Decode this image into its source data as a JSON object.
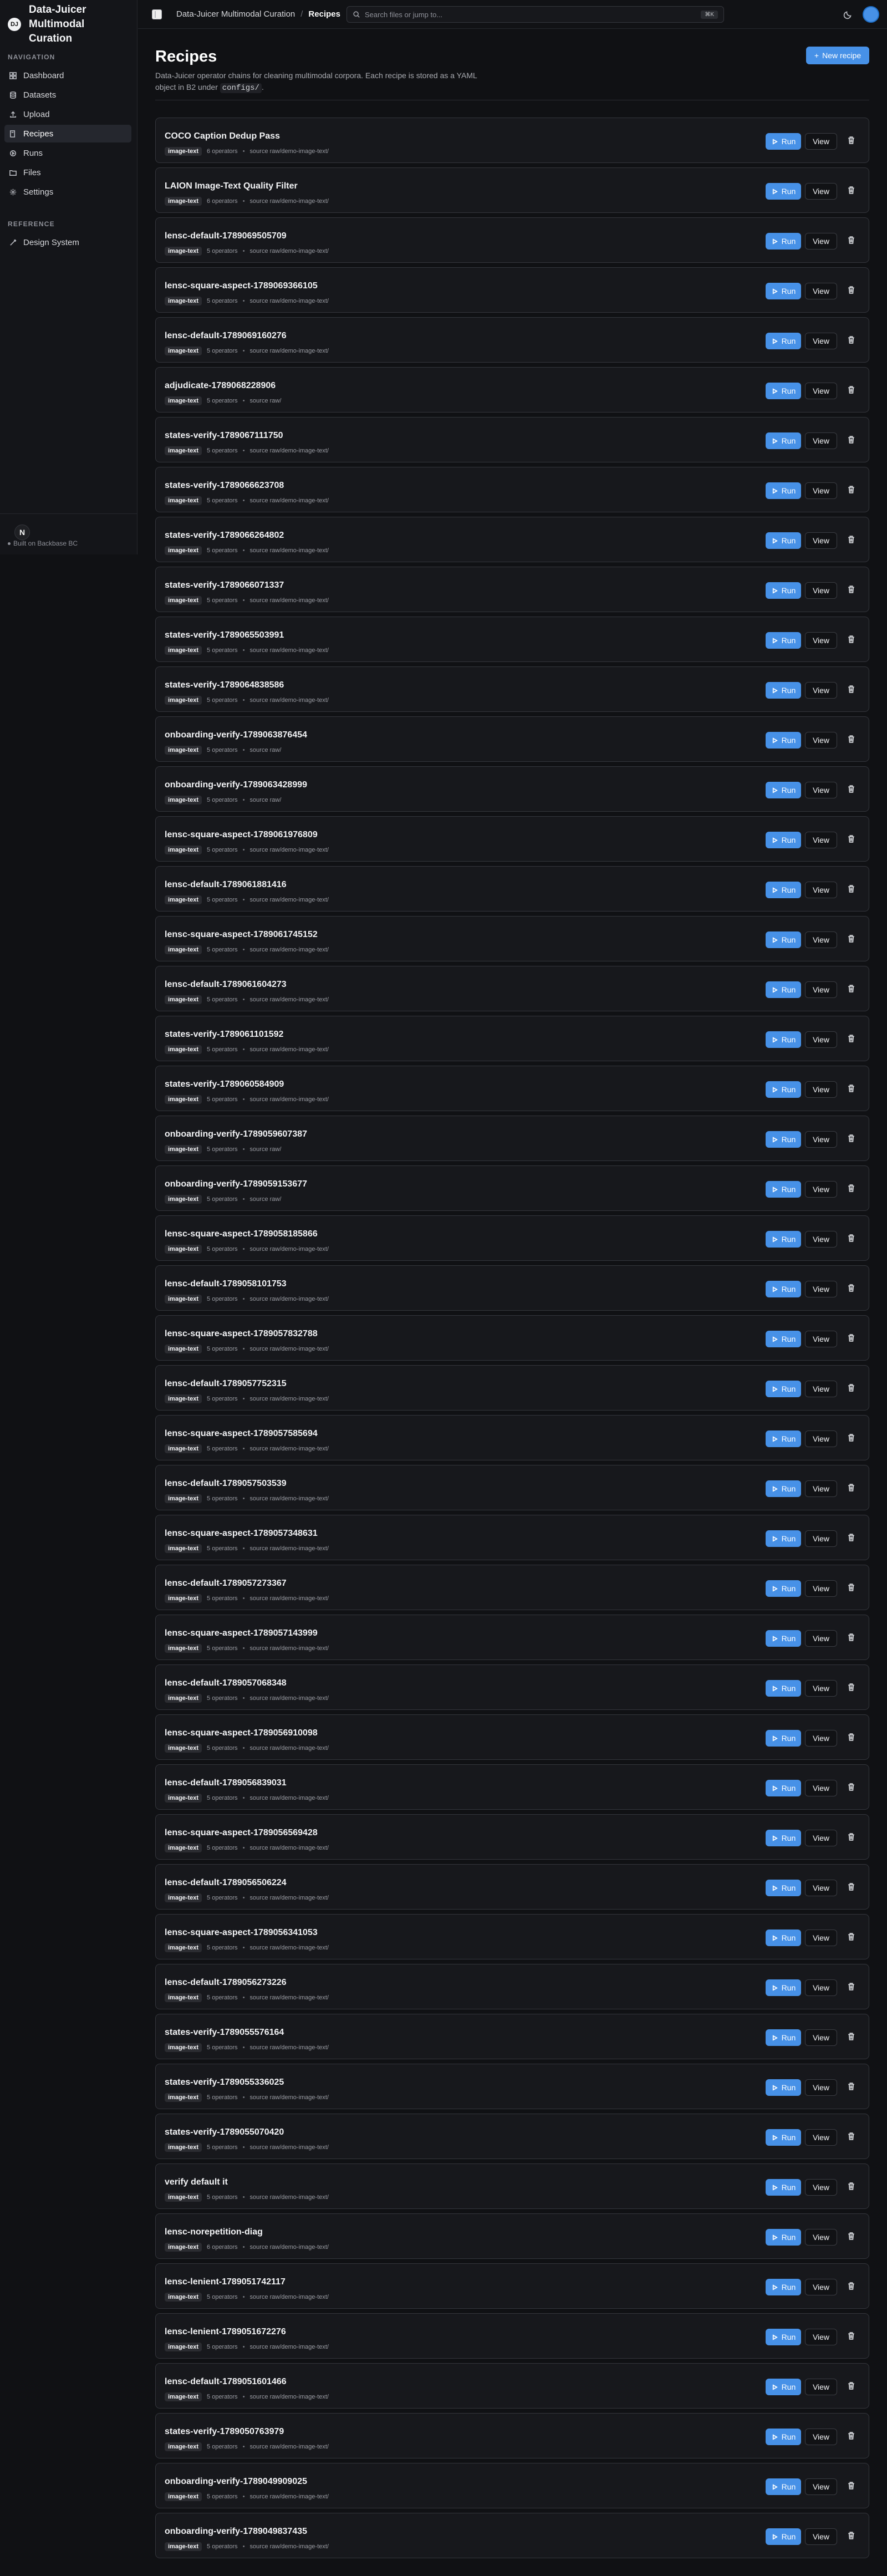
{
  "app": {
    "title": "Data-Juicer Multimodal Curation",
    "logo_text": "DJ",
    "builder_mark": "N",
    "builder_text": "Built on Backbase BC"
  },
  "sidebar": {
    "navigation_heading": "NAVIGATION",
    "reference_heading": "REFERENCE",
    "items": [
      {
        "label": "Dashboard",
        "icon": "dashboard-icon"
      },
      {
        "label": "Datasets",
        "icon": "database-icon"
      },
      {
        "label": "Upload",
        "icon": "upload-icon"
      },
      {
        "label": "Recipes",
        "icon": "book-icon",
        "active": true
      },
      {
        "label": "Runs",
        "icon": "runs-icon"
      },
      {
        "label": "Files",
        "icon": "folder-icon"
      },
      {
        "label": "Settings",
        "icon": "gear-icon"
      }
    ],
    "reference_items": [
      {
        "label": "Design System",
        "icon": "wand-icon"
      }
    ]
  },
  "topbar": {
    "breadcrumb_app": "Data-Juicer Multimodal Curation",
    "breadcrumb_separator": "/",
    "breadcrumb_current": "Recipes",
    "search_placeholder": "Search files or jump to...",
    "search_shortcut": "⌘K",
    "colors": {
      "accent": "#4791e7"
    }
  },
  "page": {
    "title": "Recipes",
    "description_before": "Data-Juicer operator chains for cleaning multimodal corpora. Each recipe is stored as a YAML object in B2 under ",
    "description_code": "configs/",
    "description_after": ".",
    "new_recipe_label": "New recipe",
    "run_label": "Run",
    "view_label": "View"
  },
  "recipes": [
    {
      "name": "COCO Caption Dedup Pass",
      "type": "image-text",
      "operators": "6 operators",
      "source": "source raw/demo-image-text/"
    },
    {
      "name": "LAION Image-Text Quality Filter",
      "type": "image-text",
      "operators": "6 operators",
      "source": "source raw/demo-image-text/"
    },
    {
      "name": "lensc-default-1789069505709",
      "type": "image-text",
      "operators": "5 operators",
      "source": "source raw/demo-image-text/"
    },
    {
      "name": "lensc-square-aspect-1789069366105",
      "type": "image-text",
      "operators": "5 operators",
      "source": "source raw/demo-image-text/"
    },
    {
      "name": "lensc-default-1789069160276",
      "type": "image-text",
      "operators": "5 operators",
      "source": "source raw/demo-image-text/"
    },
    {
      "name": "adjudicate-1789068228906",
      "type": "image-text",
      "operators": "5 operators",
      "source": "source raw/"
    },
    {
      "name": "states-verify-1789067111750",
      "type": "image-text",
      "operators": "5 operators",
      "source": "source raw/demo-image-text/"
    },
    {
      "name": "states-verify-1789066623708",
      "type": "image-text",
      "operators": "5 operators",
      "source": "source raw/demo-image-text/"
    },
    {
      "name": "states-verify-1789066264802",
      "type": "image-text",
      "operators": "5 operators",
      "source": "source raw/demo-image-text/"
    },
    {
      "name": "states-verify-1789066071337",
      "type": "image-text",
      "operators": "5 operators",
      "source": "source raw/demo-image-text/"
    },
    {
      "name": "states-verify-1789065503991",
      "type": "image-text",
      "operators": "5 operators",
      "source": "source raw/demo-image-text/"
    },
    {
      "name": "states-verify-1789064838586",
      "type": "image-text",
      "operators": "5 operators",
      "source": "source raw/demo-image-text/"
    },
    {
      "name": "onboarding-verify-1789063876454",
      "type": "image-text",
      "operators": "5 operators",
      "source": "source raw/"
    },
    {
      "name": "onboarding-verify-1789063428999",
      "type": "image-text",
      "operators": "5 operators",
      "source": "source raw/"
    },
    {
      "name": "lensc-square-aspect-1789061976809",
      "type": "image-text",
      "operators": "5 operators",
      "source": "source raw/demo-image-text/"
    },
    {
      "name": "lensc-default-1789061881416",
      "type": "image-text",
      "operators": "5 operators",
      "source": "source raw/demo-image-text/"
    },
    {
      "name": "lensc-square-aspect-1789061745152",
      "type": "image-text",
      "operators": "5 operators",
      "source": "source raw/demo-image-text/"
    },
    {
      "name": "lensc-default-1789061604273",
      "type": "image-text",
      "operators": "5 operators",
      "source": "source raw/demo-image-text/"
    },
    {
      "name": "states-verify-1789061101592",
      "type": "image-text",
      "operators": "5 operators",
      "source": "source raw/demo-image-text/"
    },
    {
      "name": "states-verify-1789060584909",
      "type": "image-text",
      "operators": "5 operators",
      "source": "source raw/demo-image-text/"
    },
    {
      "name": "onboarding-verify-1789059607387",
      "type": "image-text",
      "operators": "5 operators",
      "source": "source raw/"
    },
    {
      "name": "onboarding-verify-1789059153677",
      "type": "image-text",
      "operators": "5 operators",
      "source": "source raw/"
    },
    {
      "name": "lensc-square-aspect-1789058185866",
      "type": "image-text",
      "operators": "5 operators",
      "source": "source raw/demo-image-text/"
    },
    {
      "name": "lensc-default-1789058101753",
      "type": "image-text",
      "operators": "5 operators",
      "source": "source raw/demo-image-text/"
    },
    {
      "name": "lensc-square-aspect-1789057832788",
      "type": "image-text",
      "operators": "5 operators",
      "source": "source raw/demo-image-text/"
    },
    {
      "name": "lensc-default-1789057752315",
      "type": "image-text",
      "operators": "5 operators",
      "source": "source raw/demo-image-text/"
    },
    {
      "name": "lensc-square-aspect-1789057585694",
      "type": "image-text",
      "operators": "5 operators",
      "source": "source raw/demo-image-text/"
    },
    {
      "name": "lensc-default-1789057503539",
      "type": "image-text",
      "operators": "5 operators",
      "source": "source raw/demo-image-text/"
    },
    {
      "name": "lensc-square-aspect-1789057348631",
      "type": "image-text",
      "operators": "5 operators",
      "source": "source raw/demo-image-text/"
    },
    {
      "name": "lensc-default-1789057273367",
      "type": "image-text",
      "operators": "5 operators",
      "source": "source raw/demo-image-text/"
    },
    {
      "name": "lensc-square-aspect-1789057143999",
      "type": "image-text",
      "operators": "5 operators",
      "source": "source raw/demo-image-text/"
    },
    {
      "name": "lensc-default-1789057068348",
      "type": "image-text",
      "operators": "5 operators",
      "source": "source raw/demo-image-text/"
    },
    {
      "name": "lensc-square-aspect-1789056910098",
      "type": "image-text",
      "operators": "5 operators",
      "source": "source raw/demo-image-text/"
    },
    {
      "name": "lensc-default-1789056839031",
      "type": "image-text",
      "operators": "5 operators",
      "source": "source raw/demo-image-text/"
    },
    {
      "name": "lensc-square-aspect-1789056569428",
      "type": "image-text",
      "operators": "5 operators",
      "source": "source raw/demo-image-text/"
    },
    {
      "name": "lensc-default-1789056506224",
      "type": "image-text",
      "operators": "5 operators",
      "source": "source raw/demo-image-text/"
    },
    {
      "name": "lensc-square-aspect-1789056341053",
      "type": "image-text",
      "operators": "5 operators",
      "source": "source raw/demo-image-text/"
    },
    {
      "name": "lensc-default-1789056273226",
      "type": "image-text",
      "operators": "5 operators",
      "source": "source raw/demo-image-text/"
    },
    {
      "name": "states-verify-1789055576164",
      "type": "image-text",
      "operators": "5 operators",
      "source": "source raw/demo-image-text/"
    },
    {
      "name": "states-verify-1789055336025",
      "type": "image-text",
      "operators": "5 operators",
      "source": "source raw/demo-image-text/"
    },
    {
      "name": "states-verify-1789055070420",
      "type": "image-text",
      "operators": "5 operators",
      "source": "source raw/demo-image-text/"
    },
    {
      "name": "verify default it",
      "type": "image-text",
      "operators": "5 operators",
      "source": "source raw/demo-image-text/"
    },
    {
      "name": "lensc-norepetition-diag",
      "type": "image-text",
      "operators": "6 operators",
      "source": "source raw/demo-image-text/"
    },
    {
      "name": "lensc-lenient-1789051742117",
      "type": "image-text",
      "operators": "5 operators",
      "source": "source raw/demo-image-text/"
    },
    {
      "name": "lensc-lenient-1789051672276",
      "type": "image-text",
      "operators": "5 operators",
      "source": "source raw/demo-image-text/"
    },
    {
      "name": "lensc-default-1789051601466",
      "type": "image-text",
      "operators": "5 operators",
      "source": "source raw/demo-image-text/"
    },
    {
      "name": "states-verify-1789050763979",
      "type": "image-text",
      "operators": "5 operators",
      "source": "source raw/demo-image-text/"
    },
    {
      "name": "onboarding-verify-1789049909025",
      "type": "image-text",
      "operators": "5 operators",
      "source": "source raw/demo-image-text/"
    },
    {
      "name": "onboarding-verify-1789049837435",
      "type": "image-text",
      "operators": "5 operators",
      "source": "source raw/demo-image-text/"
    }
  ]
}
